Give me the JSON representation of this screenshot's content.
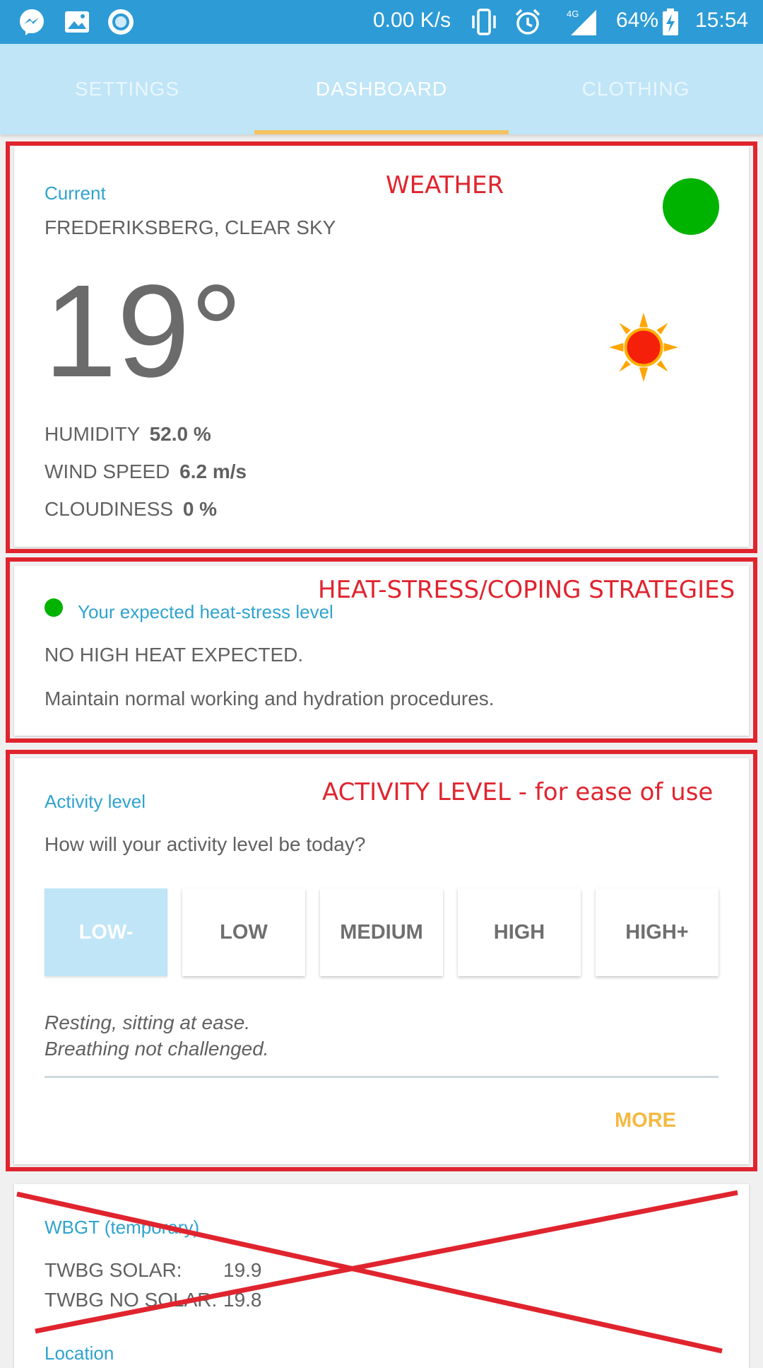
{
  "status_bar": {
    "network_speed": "0.00 K/s",
    "network_type": "4G",
    "battery": "64%",
    "time": "15:54",
    "icons": [
      "messenger-icon",
      "gallery-icon",
      "app-circle-icon",
      "vibrate-icon",
      "alarm-icon",
      "signal-icon",
      "battery-charging-icon"
    ]
  },
  "tabs": [
    {
      "label": "SETTINGS",
      "active": false
    },
    {
      "label": "DASHBOARD",
      "active": true
    },
    {
      "label": "CLOTHING",
      "active": false
    }
  ],
  "annotations": {
    "weather": "WEATHER",
    "heat_stress": "HEAT-STRESS/COPING STRATEGIES",
    "activity": "ACTIVITY LEVEL - for ease of use"
  },
  "weather": {
    "section_label": "Current",
    "location": "FREDERIKSBERG, CLEAR SKY",
    "temperature": "19°",
    "condition_icon": "sun-icon",
    "status_color": "#00b300",
    "humidity_label": "HUMIDITY",
    "humidity_value": "52.0 %",
    "wind_label": "WIND SPEED",
    "wind_value": "6.2 m/s",
    "cloud_label": "CLOUDINESS",
    "cloud_value": "0 %"
  },
  "heat_stress": {
    "section_label": "Your expected heat-stress level",
    "level_color": "#00b300",
    "headline": "NO HIGH HEAT EXPECTED.",
    "advice": "Maintain normal working and hydration procedures."
  },
  "activity": {
    "section_label": "Activity level",
    "question": "How will your activity level be today?",
    "options": [
      "LOW-",
      "LOW",
      "MEDIUM",
      "HIGH",
      "HIGH+"
    ],
    "selected": "LOW-",
    "description_line1": "Resting, sitting at ease.",
    "description_line2": "Breathing not challenged.",
    "more_label": "MORE"
  },
  "wbgt": {
    "section_label": "WBGT (temporary)",
    "solar_label": "TWBG SOLAR:",
    "solar_value": "19.9",
    "no_solar_label": "TWBG NO SOLAR:",
    "no_solar_value": "19.8",
    "next_label": "Location"
  },
  "colors": {
    "status_bar": "#2d9bd6",
    "tab_bar": "#bfe5f7",
    "tab_indicator": "#f4c261",
    "accent_blue": "#2fa3cf",
    "annotation_red": "#e0242e",
    "more_orange": "#f4b942"
  }
}
